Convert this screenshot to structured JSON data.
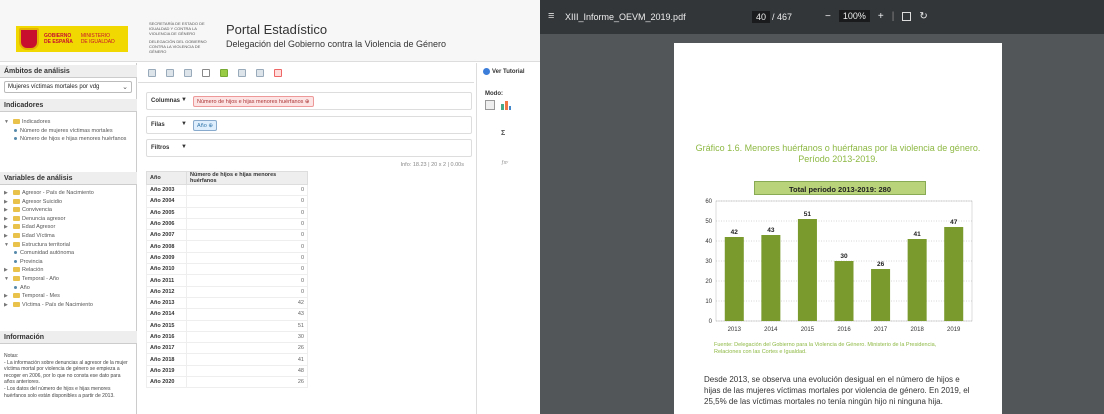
{
  "portal": {
    "gov_text": "GOBIERNO\nDE ESPAÑA",
    "ministry_text": "MINISTERIO\nDE IGUALDAD",
    "sec_block": "SECRETARÍA DE ESTADO DE IGUALDAD Y CONTRA LA VIOLENCIA DE GÉNERO",
    "sec_block2": "DELEGACIÓN DEL GOBIERNO CONTRA LA VIOLENCIA DE GÉNERO",
    "title": "Portal Estadístico",
    "subtitle": "Delegación del Gobierno contra la Violencia de Género"
  },
  "sidebar": {
    "ambitos_head": "Ámbitos de análisis",
    "ambito_select": "Mujeres víctimas mortales por vdg",
    "indicadores_head": "Indicadores",
    "indicator_tree": [
      {
        "kind": "folder",
        "label": "Indicadores",
        "open": true
      },
      {
        "kind": "dot",
        "label": "Número de mujeres víctimas mortales"
      },
      {
        "kind": "dot",
        "label": "Número de hijos e hijas menores huérfanos"
      }
    ],
    "variables_head": "Variables de análisis",
    "variable_tree": [
      {
        "kind": "folder",
        "label": "Agresor - País de Nacimiento"
      },
      {
        "kind": "folder",
        "label": "Agresor Suicidio"
      },
      {
        "kind": "folder",
        "label": "Convivencia"
      },
      {
        "kind": "folder",
        "label": "Denuncia agresor"
      },
      {
        "kind": "folder",
        "label": "Edad Agresor"
      },
      {
        "kind": "folder",
        "label": "Edad Víctima"
      },
      {
        "kind": "folder",
        "label": "Estructura territorial",
        "open": true
      },
      {
        "kind": "dot",
        "label": "Comunidad autónoma"
      },
      {
        "kind": "dot",
        "label": "Provincia"
      },
      {
        "kind": "folder",
        "label": "Relación"
      },
      {
        "kind": "folder",
        "label": "Temporal - Año",
        "open": true
      },
      {
        "kind": "dot",
        "label": "Año"
      },
      {
        "kind": "folder",
        "label": "Temporal - Mes"
      },
      {
        "kind": "folder",
        "label": "Víctima - País de Nacimiento"
      }
    ],
    "info_head": "Información",
    "notes": "Notas:\n- La información sobre denuncias al agresor de la mujer víctima mortal por violencia de género se empieza a recoger en 2006, por lo que no consta ese dato para años anteriores.\n- Los datos del número de hijos e hijas menores huérfanos solo están disponibles a partir de 2013."
  },
  "center": {
    "columns_label": "Columnas",
    "columns_chip": "Número de hijos e hijas menores huérfanos",
    "rows_label": "Filas",
    "rows_chip": "Año",
    "filters_label": "Filtros",
    "info": "Info: 18.23 | 20 x 2 | 0.00s",
    "table_headers": [
      "Año",
      "Número de hijos e hijas menores huérfanos"
    ],
    "table_rows": [
      [
        "Año 2003",
        "0"
      ],
      [
        "Año 2004",
        "0"
      ],
      [
        "Año 2005",
        "0"
      ],
      [
        "Año 2006",
        "0"
      ],
      [
        "Año 2007",
        "0"
      ],
      [
        "Año 2008",
        "0"
      ],
      [
        "Año 2009",
        "0"
      ],
      [
        "Año 2010",
        "0"
      ],
      [
        "Año 2011",
        "0"
      ],
      [
        "Año 2012",
        "0"
      ],
      [
        "Año 2013",
        "42"
      ],
      [
        "Año 2014",
        "43"
      ],
      [
        "Año 2015",
        "51"
      ],
      [
        "Año 2016",
        "30"
      ],
      [
        "Año 2017",
        "26"
      ],
      [
        "Año 2018",
        "41"
      ],
      [
        "Año 2019",
        "48"
      ],
      [
        "Año 2020",
        "26"
      ]
    ]
  },
  "rpanel": {
    "tutorial": "Ver Tutorial",
    "modo": "Modo:",
    "sigma": "Σ",
    "sigma2": "ƒxʸ"
  },
  "pdf": {
    "menu_icon": "≡",
    "filename": "XIII_Informe_OEVM_2019.pdf",
    "page_current": "40",
    "page_total": "/ 467",
    "zoom": "100%",
    "minus": "−",
    "plus": "+",
    "rotate": "↻",
    "figure_title": "Gráfico 1.6. Menores huérfanos o huérfanas por la violencia de género.\nPeríodo 2013-2019.",
    "total_label": "Total periodo 2013-2019: 280",
    "source": "Fuente: Delegación del Gobierno para la Violencia de Género. Ministerio de la Presidencia, Relaciones con las Cortes e Igualdad.",
    "body_text": "Desde 2013, se observa una evolución desigual en el número de hijos e hijas de las mujeres víctimas mortales por violencia de género. En 2019, el 25,5% de las víctimas mortales no tenía ningún hijo ni ninguna hija."
  },
  "chart_data": {
    "type": "bar",
    "categories": [
      "2013",
      "2014",
      "2015",
      "2016",
      "2017",
      "2018",
      "2019"
    ],
    "values": [
      42,
      43,
      51,
      30,
      26,
      41,
      47
    ],
    "ylim": [
      0,
      60
    ],
    "yticks": [
      0,
      10,
      20,
      30,
      40,
      50,
      60
    ],
    "bar_color": "#7a9a2e",
    "grid": true
  }
}
